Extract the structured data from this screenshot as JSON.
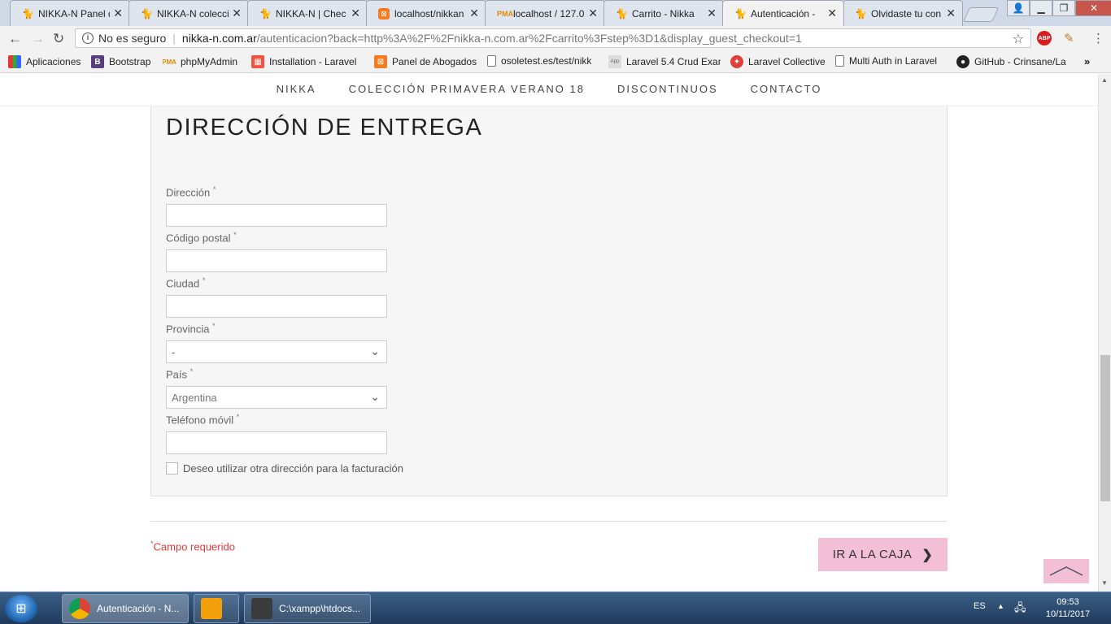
{
  "tabs": [
    {
      "title": "NIKKA-N Panel d",
      "icon": "cat-icon"
    },
    {
      "title": "NIKKA-N colecci",
      "icon": "cat-icon"
    },
    {
      "title": "NIKKA-N | Chec",
      "icon": "cat-icon"
    },
    {
      "title": "localhost/nikkan",
      "icon": "xampp-icon"
    },
    {
      "title": "localhost / 127.0",
      "icon": "pma-icon"
    },
    {
      "title": "Carrito - Nikka",
      "icon": "cat-icon"
    },
    {
      "title": "Autenticación -",
      "icon": "cat-icon"
    },
    {
      "title": "Olvidaste tu con",
      "icon": "cat-icon"
    }
  ],
  "omnibox": {
    "security": "No es seguro",
    "host": "nikka-n.com.ar",
    "path": "/autenticacion?back=http%3A%2F%2Fnikka-n.com.ar%2Fcarrito%3Fstep%3D1&display_guest_checkout=1"
  },
  "extensions": {
    "abp": "ABP"
  },
  "bookmarks": [
    {
      "label": "Aplicaciones",
      "icon": "apps-grid-icon"
    },
    {
      "label": "Bootstrap",
      "icon": "bootstrap-icon"
    },
    {
      "label": "phpMyAdmin",
      "icon": "pma-icon"
    },
    {
      "label": "Installation - Laravel",
      "icon": "laravel-icon"
    },
    {
      "label": "Panel de Abogados",
      "icon": "xampp-icon"
    },
    {
      "label": "osoletest.es/test/nikk",
      "icon": "page-icon"
    },
    {
      "label": "Laravel 5.4 Crud Exan",
      "icon": "appdiv-icon"
    },
    {
      "label": "Laravel Collective",
      "icon": "collective-icon"
    },
    {
      "label": "Multi Auth in Laravel",
      "icon": "page-icon"
    },
    {
      "label": "GitHub - Crinsane/La",
      "icon": "github-icon"
    }
  ],
  "sitenav": [
    "NIKKA",
    "COLECCIÓN PRIMAVERA VERANO 18",
    "DISCONTINUOS",
    "CONTACTO"
  ],
  "form": {
    "title": "DIRECCIÓN DE ENTREGA",
    "required_mark": "*",
    "fields": [
      {
        "label": "Dirección",
        "value": ""
      },
      {
        "label": "Código postal",
        "value": ""
      },
      {
        "label": "Ciudad",
        "value": ""
      },
      {
        "label": "Provincia",
        "value": "-"
      },
      {
        "label": "País",
        "value": "Argentina"
      },
      {
        "label": "Teléfono móvil",
        "value": ""
      }
    ],
    "billing_checkbox_label": "Deseo utilizar otra dirección para la facturación"
  },
  "footer": {
    "required_note": "Campo requerido",
    "checkout_label": "IR A LA CAJA"
  },
  "taskbar": {
    "items": [
      {
        "label": "Autenticación - N..."
      },
      {
        "label": ""
      },
      {
        "label": "C:\\xampp\\htdocs..."
      }
    ],
    "lang": "ES",
    "time": "09:53",
    "date": "10/11/2017"
  },
  "colors": {
    "accent_pink": "#f3bfd6",
    "required_red": "#e03a3a"
  }
}
